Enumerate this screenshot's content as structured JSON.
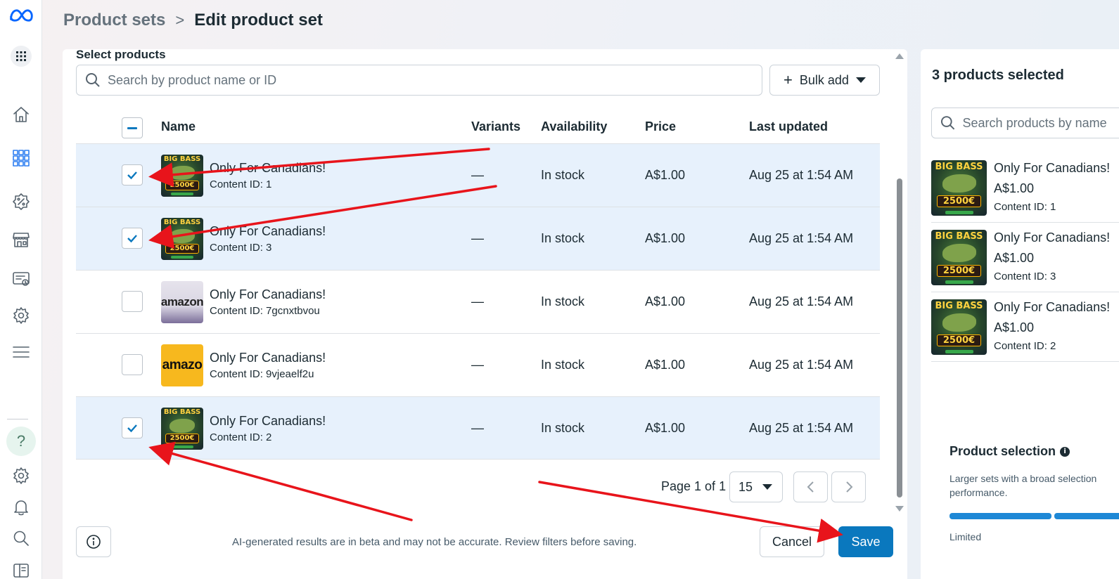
{
  "header": {
    "breadcrumb_parent": "Product sets",
    "breadcrumb_separator": ">",
    "breadcrumb_current": "Edit product set"
  },
  "main": {
    "section_title": "Select products",
    "search_placeholder": "Search by product name or ID",
    "bulk_add_label": "Bulk add",
    "columns": {
      "name": "Name",
      "variants": "Variants",
      "availability": "Availability",
      "price": "Price",
      "last_updated": "Last updated"
    },
    "rows": [
      {
        "name": "Only For Canadians!",
        "content_id": "Content ID: 1",
        "variants": "—",
        "availability": "In stock",
        "price": "A$1.00",
        "last_updated": "Aug 25 at 1:54 AM",
        "selected": true,
        "thumb": "big-bass"
      },
      {
        "name": "Only For Canadians!",
        "content_id": "Content ID: 3",
        "variants": "—",
        "availability": "In stock",
        "price": "A$1.00",
        "last_updated": "Aug 25 at 1:54 AM",
        "selected": true,
        "thumb": "big-bass"
      },
      {
        "name": "Only For Canadians!",
        "content_id": "Content ID: 7gcnxtbvou",
        "variants": "—",
        "availability": "In stock",
        "price": "A$1.00",
        "last_updated": "Aug 25 at 1:54 AM",
        "selected": false,
        "thumb": "amazon-light"
      },
      {
        "name": "Only For Canadians!",
        "content_id": "Content ID: 9vjeaelf2u",
        "variants": "—",
        "availability": "In stock",
        "price": "A$1.00",
        "last_updated": "Aug 25 at 1:54 AM",
        "selected": false,
        "thumb": "amazon-yellow"
      },
      {
        "name": "Only For Canadians!",
        "content_id": "Content ID: 2",
        "variants": "—",
        "availability": "In stock",
        "price": "A$1.00",
        "last_updated": "Aug 25 at 1:54 AM",
        "selected": true,
        "thumb": "big-bass"
      }
    ],
    "thumb_text": {
      "bass_title": "BIG BASS",
      "bass_amount": "2500€",
      "amazon_1": "amazon",
      "amazon_2": "amazo"
    },
    "pagination": {
      "text": "Page 1 of 1",
      "page_size": "15"
    },
    "footer_note": "AI-generated results are in beta and may not be accurate. Review filters before saving.",
    "cancel_label": "Cancel",
    "save_label": "Save"
  },
  "right_panel": {
    "title": "3 products selected",
    "search_placeholder": "Search products by name",
    "items": [
      {
        "name": "Only For Canadians!",
        "price": "A$1.00",
        "content_id": "Content ID: 1"
      },
      {
        "name": "Only For Canadians!",
        "price": "A$1.00",
        "content_id": "Content ID: 3"
      },
      {
        "name": "Only For Canadians!",
        "price": "A$1.00",
        "content_id": "Content ID: 2"
      }
    ],
    "product_selection_title": "Product selection",
    "product_selection_desc": "Larger sets with a broad selection performance.",
    "level_label": "Limited"
  },
  "colors": {
    "accent": "#0a78be",
    "selected_row": "#e7f1fc",
    "annotation_arrow": "#e8141b",
    "meta_logo": "#0866ff"
  },
  "icons": [
    "meta-logo-icon",
    "apps-grid-icon",
    "home-icon",
    "catalog-grid-icon",
    "promotions-icon",
    "shop-icon",
    "data-sources-icon",
    "settings-icon",
    "menu-icon",
    "help-icon",
    "gear-icon",
    "bell-icon",
    "search-icon",
    "side-panel-icon",
    "info-icon",
    "chevron-left-icon",
    "chevron-right-icon",
    "check-icon"
  ]
}
